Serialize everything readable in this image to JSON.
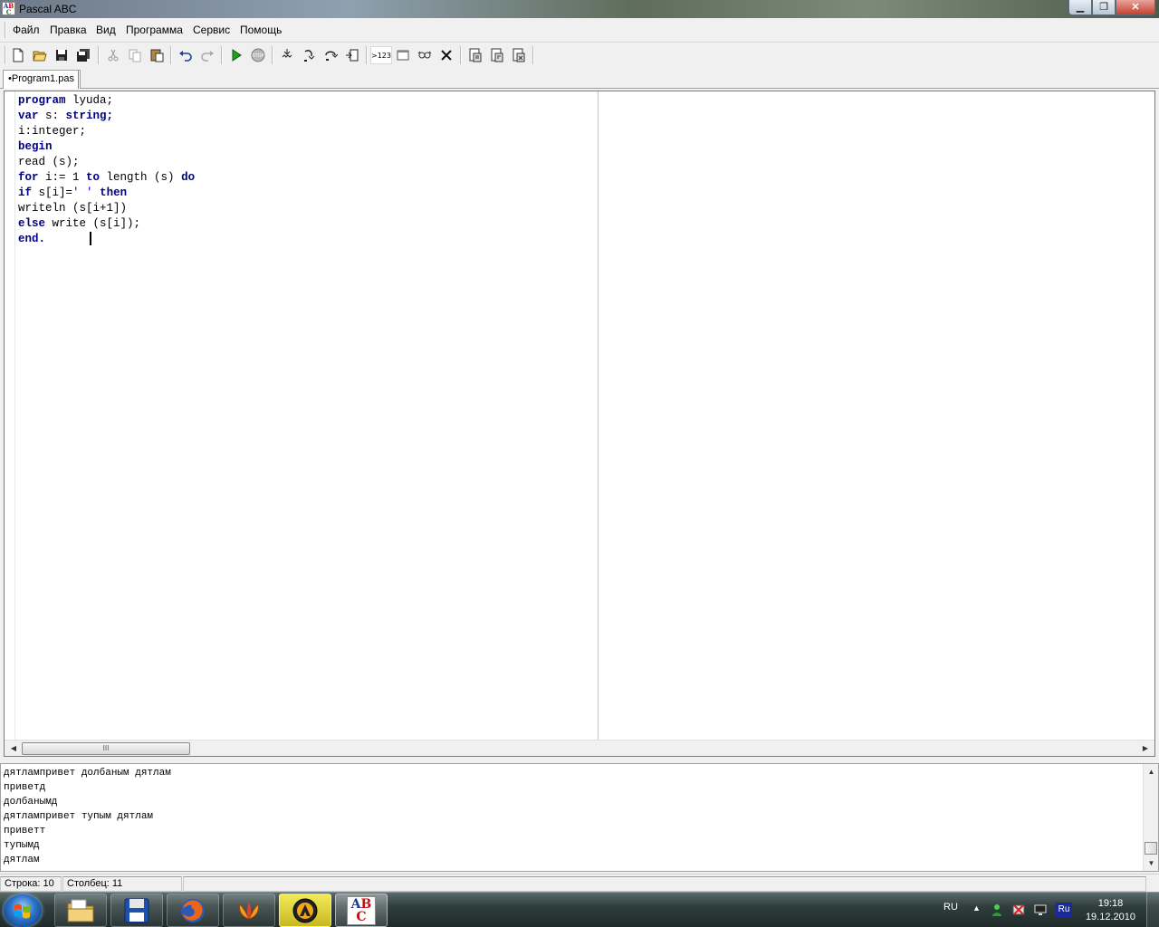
{
  "window": {
    "title": "Pascal ABC",
    "icon_letters": [
      "A",
      "B",
      "C"
    ],
    "minimize_glyph": "▁",
    "maximize_glyph": "❐",
    "close_glyph": "✕"
  },
  "menu": [
    "Файл",
    "Правка",
    "Вид",
    "Программа",
    "Сервис",
    "Помощь"
  ],
  "toolbar": {
    "buttons": [
      {
        "name": "new-file",
        "icon": "new-file-icon"
      },
      {
        "name": "open",
        "icon": "open-folder-icon"
      },
      {
        "name": "save",
        "icon": "save-icon"
      },
      {
        "name": "save-all",
        "icon": "save-all-icon"
      },
      {
        "name": "cut",
        "icon": "scissors-icon"
      },
      {
        "name": "copy",
        "icon": "copy-icon"
      },
      {
        "name": "paste",
        "icon": "paste-icon"
      },
      {
        "name": "undo",
        "icon": "undo-icon"
      },
      {
        "name": "redo",
        "icon": "redo-icon"
      },
      {
        "name": "run",
        "icon": "run-icon"
      },
      {
        "name": "stop",
        "icon": "stop-icon"
      },
      {
        "name": "step-into",
        "icon": "step-into-icon"
      },
      {
        "name": "step-over",
        "icon": "step-over-icon"
      },
      {
        "name": "step-out",
        "icon": "step-out-icon"
      },
      {
        "name": "run-to-cursor",
        "icon": "run-to-cursor-icon"
      },
      {
        "name": "watch",
        "icon": "watch-icon"
      },
      {
        "name": "output-window",
        "icon": "window-icon"
      },
      {
        "name": "eye",
        "icon": "eye-icon"
      },
      {
        "name": "delete",
        "icon": "close-x-icon"
      },
      {
        "name": "tool-a",
        "icon": "document-tool-icon"
      },
      {
        "name": "tool-b",
        "icon": "document-tool-icon"
      },
      {
        "name": "tool-c",
        "icon": "document-tool-icon"
      }
    ],
    "watch_label": ">123",
    "stop_label": "STOP"
  },
  "tab": {
    "label": "•Program1.pas"
  },
  "editor": {
    "lines": [
      [
        {
          "t": "program",
          "k": true
        },
        {
          "t": " lyuda;"
        }
      ],
      [
        {
          "t": "var",
          "k": true
        },
        {
          "t": " s: "
        },
        {
          "t": "string;",
          "k": true
        }
      ],
      [
        {
          "t": "i:integer;"
        }
      ],
      [
        {
          "t": "begin",
          "k": true
        }
      ],
      [
        {
          "t": "read (s);"
        }
      ],
      [
        {
          "t": "for",
          "k": true
        },
        {
          "t": " i:= 1 "
        },
        {
          "t": "to",
          "k": true
        },
        {
          "t": " length (s) "
        },
        {
          "t": "do",
          "k": true
        }
      ],
      [
        {
          "t": "if",
          "k": true
        },
        {
          "t": " s[i]="
        },
        {
          "t": "' '",
          "s": true
        },
        {
          "t": " "
        },
        {
          "t": "then",
          "k": true
        }
      ],
      [
        {
          "t": "writeln (s[i+1])"
        }
      ],
      [
        {
          "t": "else",
          "k": true
        },
        {
          "t": " write (s[i]);"
        }
      ],
      [
        {
          "t": "end.",
          "k": true
        }
      ]
    ],
    "hscroll_thumb_label": "III"
  },
  "output": {
    "lines": [
      "дятлампривет долбаным дятлам",
      "приветд",
      "долбанымд",
      "дятлампривет тупым дятлам",
      "приветт",
      "тупымд",
      "дятлам"
    ]
  },
  "status": {
    "line": "Строка: 10",
    "column": "Столбец: 11"
  },
  "taskbar": {
    "apps": [
      {
        "name": "explorer",
        "icon": "folder-icon"
      },
      {
        "name": "save-app",
        "icon": "floppy-icon"
      },
      {
        "name": "firefox",
        "icon": "firefox-icon"
      },
      {
        "name": "flower-app",
        "icon": "flower-icon"
      },
      {
        "name": "aimp",
        "icon": "aimp-icon"
      },
      {
        "name": "pascal-abc",
        "icon": "pascal-abc-icon",
        "label": "ABC"
      }
    ],
    "lang": "RU",
    "lang_badge": "Ru",
    "time": "19:18",
    "date": "19.12.2010"
  },
  "colors": {
    "keyword": "#000080",
    "string": "#0000ff",
    "window_bg": "#f0f0f0"
  }
}
